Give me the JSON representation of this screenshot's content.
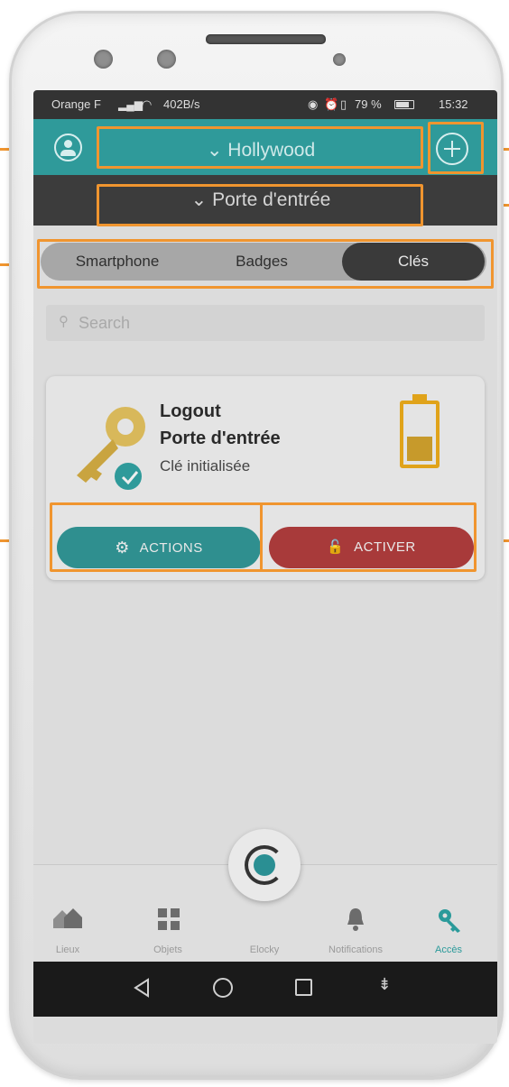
{
  "status_bar": {
    "carrier": "Orange F",
    "speed": "402B/s",
    "battery": "79 %",
    "time": "15:32"
  },
  "header": {
    "location": "Hollywood",
    "door": "Porte d'entrée"
  },
  "tabs": [
    {
      "label": "Smartphone",
      "active": false
    },
    {
      "label": "Badges",
      "active": false
    },
    {
      "label": "Clés",
      "active": true
    }
  ],
  "search": {
    "placeholder": "Search"
  },
  "key_card": {
    "name": "Logout",
    "door": "Porte d'entrée",
    "status": "Clé initialisée",
    "battery_level": 0.45,
    "actions_label": "ACTIONS",
    "activate_label": "ACTIVER"
  },
  "bottom_nav": {
    "items": [
      {
        "label": "Lieux",
        "icon": "houses-icon"
      },
      {
        "label": "Objets",
        "icon": "grid-icon"
      },
      {
        "label": "Elocky",
        "icon": "elocky-logo-icon"
      },
      {
        "label": "Notifications",
        "icon": "bell-icon"
      },
      {
        "label": "Accès",
        "icon": "key-icon",
        "active": true
      }
    ]
  },
  "colors": {
    "teal": "#2f9a9a",
    "red": "#a83a3a",
    "highlight": "#f0952f",
    "battery_gold": "#e0a31a"
  }
}
